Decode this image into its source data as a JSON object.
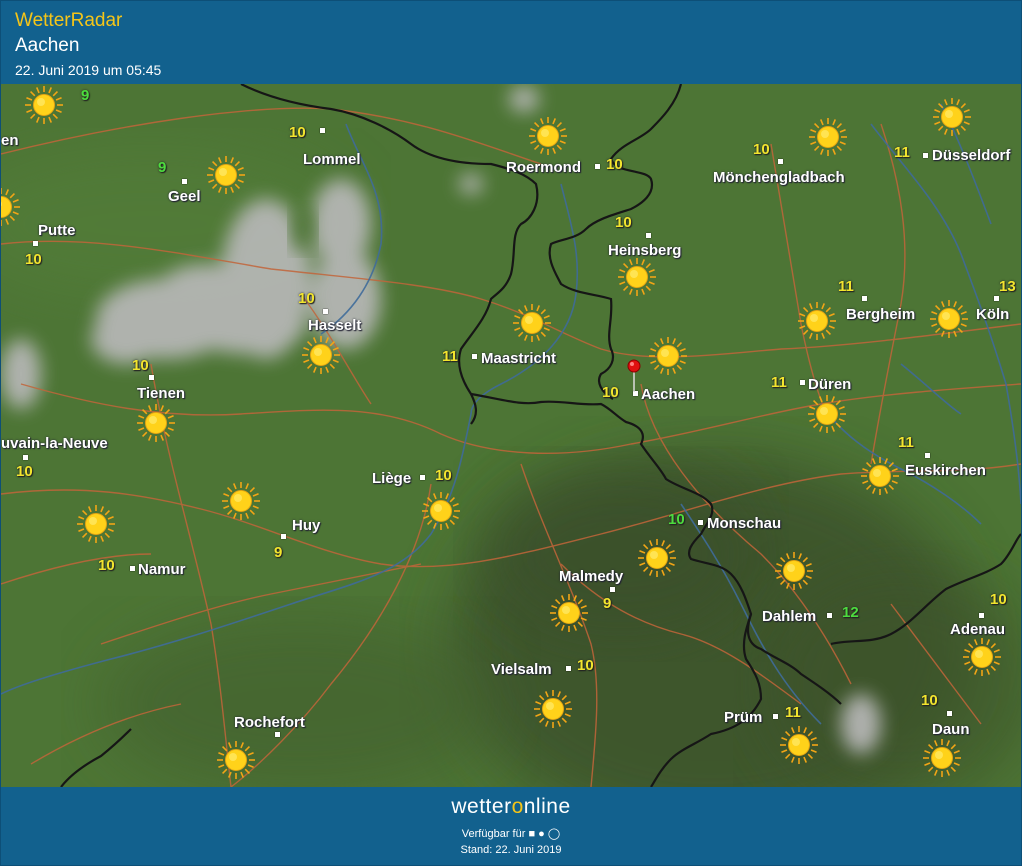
{
  "header": {
    "app_title": "WetterRadar",
    "location": "Aachen",
    "timestamp": "22. Juni 2019 um 05:45"
  },
  "map": {
    "colors": {
      "land": "#4a6f33",
      "border": "#151515",
      "river": "#3f6b9a",
      "road": "#c2653a",
      "cloud": "#b4b4b4"
    },
    "cities": [
      {
        "name": "Lommel"
      },
      {
        "name": "Roermond"
      },
      {
        "name": "Mönchengladbach"
      },
      {
        "name": "Düsseldorf"
      },
      {
        "name": "Geel"
      },
      {
        "name": "Putte"
      },
      {
        "name": "Heinsberg"
      },
      {
        "name": "Hasselt"
      },
      {
        "name": "Bergheim"
      },
      {
        "name": "Köln"
      },
      {
        "name": "Maastricht"
      },
      {
        "name": "Tienen"
      },
      {
        "name": "Aachen"
      },
      {
        "name": "Düren"
      },
      {
        "name": "uvain-la-Neuve"
      },
      {
        "name": "Euskirchen"
      },
      {
        "name": "Liège"
      },
      {
        "name": "Huy"
      },
      {
        "name": "Monschau"
      },
      {
        "name": "Namur"
      },
      {
        "name": "Malmedy"
      },
      {
        "name": "Dahlem"
      },
      {
        "name": "Adenau"
      },
      {
        "name": "Vielsalm"
      },
      {
        "name": "Prüm"
      },
      {
        "name": "Daun"
      },
      {
        "name": "Rochefort"
      },
      {
        "name": "en"
      }
    ],
    "temperatures": [
      {
        "value": "9"
      },
      {
        "value": "10"
      },
      {
        "value": "9"
      },
      {
        "value": "10"
      },
      {
        "value": "10"
      },
      {
        "value": "10"
      },
      {
        "value": "11"
      },
      {
        "value": "10"
      },
      {
        "value": "10"
      },
      {
        "value": "11"
      },
      {
        "value": "13"
      },
      {
        "value": "10"
      },
      {
        "value": "11"
      },
      {
        "value": "10"
      },
      {
        "value": "11"
      },
      {
        "value": "10"
      },
      {
        "value": "11"
      },
      {
        "value": "10"
      },
      {
        "value": "9"
      },
      {
        "value": "10"
      },
      {
        "value": "10"
      },
      {
        "value": "9"
      },
      {
        "value": "12"
      },
      {
        "value": "10"
      },
      {
        "value": "10"
      },
      {
        "value": "11"
      },
      {
        "value": "10"
      }
    ],
    "weather_icons": "sun-icon"
  },
  "footer": {
    "brand_pre": "wetter",
    "brand_o": "o",
    "brand_post": "nline",
    "availability": "Verfügbar für",
    "stand": "Stand: 22. Juni 2019"
  }
}
